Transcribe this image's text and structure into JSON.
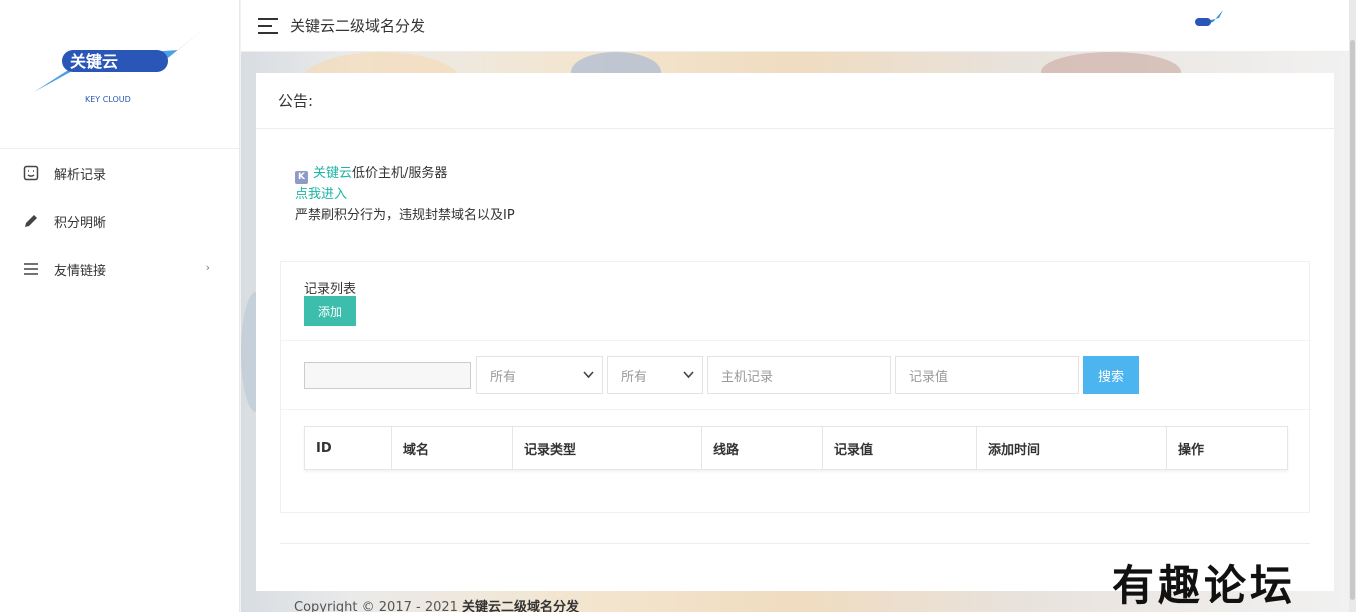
{
  "app": {
    "title": "关键云二级域名分发",
    "logo_text": "关键云",
    "logo_sub": "KEY CLOUD"
  },
  "sidebar": {
    "items": [
      {
        "label": "解析记录",
        "icon": "note-icon"
      },
      {
        "label": "积分明晰",
        "icon": "pencil-icon"
      },
      {
        "label": "友情链接",
        "icon": "menu-lines-icon",
        "arrow": "›"
      }
    ]
  },
  "notice": {
    "heading": "公告:",
    "brand_link": "关键云",
    "line1_rest": "低价主机/服务器",
    "enter_link": "点我进入",
    "line3": "严禁刷积分行为，违规封禁域名以及IP"
  },
  "records": {
    "title": "记录列表",
    "add_label": "添加",
    "filters": {
      "domain_value": "",
      "type_select": "所有",
      "line_select": "所有",
      "host_placeholder": "主机记录",
      "value_placeholder": "记录值",
      "search_label": "搜索"
    },
    "columns": [
      "ID",
      "域名",
      "记录类型",
      "线路",
      "记录值",
      "添加时间",
      "操作"
    ]
  },
  "footer": {
    "prefix": "Copyright © 2017 - 2021 ",
    "brand": "关键云二级域名分发"
  },
  "watermark": "有趣论坛",
  "colors": {
    "accent_teal": "#3dbeac",
    "link_teal": "#1cb5a5",
    "search_blue": "#4cb4ee",
    "logo_blue": "#2a56b8"
  }
}
